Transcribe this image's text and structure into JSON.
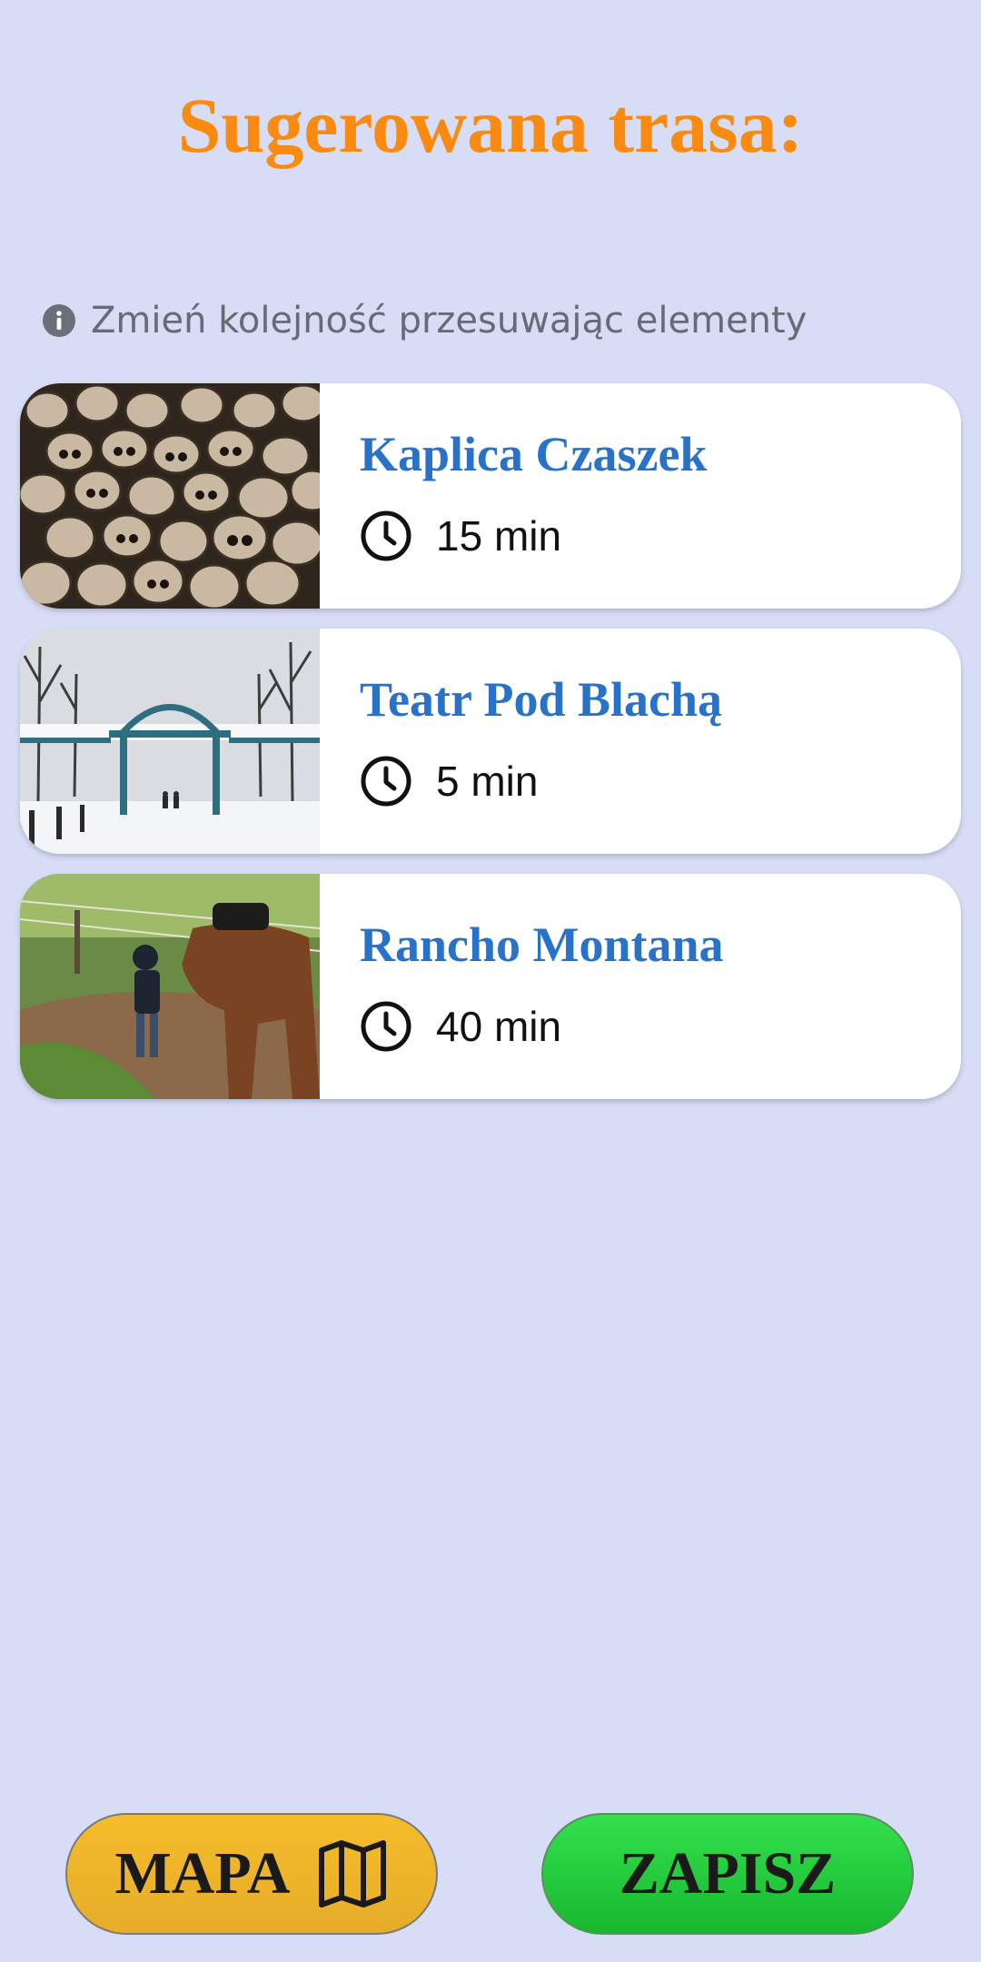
{
  "header": {
    "title": "Sugerowana trasa:"
  },
  "hint": {
    "text": "Zmień kolejność przesuwając elementy",
    "icon": "info-icon"
  },
  "route": [
    {
      "name": "Kaplica Czaszek",
      "duration": "15 min",
      "image": "skulls-photo",
      "icon": "clock-icon"
    },
    {
      "name": "Teatr Pod Blachą",
      "duration": "5 min",
      "image": "snowy-park-gate-photo",
      "icon": "clock-icon"
    },
    {
      "name": "Rancho Montana",
      "duration": "40 min",
      "image": "child-with-horse-photo",
      "icon": "clock-icon"
    }
  ],
  "buttons": {
    "map_label": "MAPA",
    "map_icon": "map-icon",
    "save_label": "ZAPISZ"
  },
  "colors": {
    "background": "#d6ddf5",
    "title": "#fb8a10",
    "place_name": "#2872c9",
    "map_button": "#f0b62a",
    "save_button": "#22cc3e"
  }
}
